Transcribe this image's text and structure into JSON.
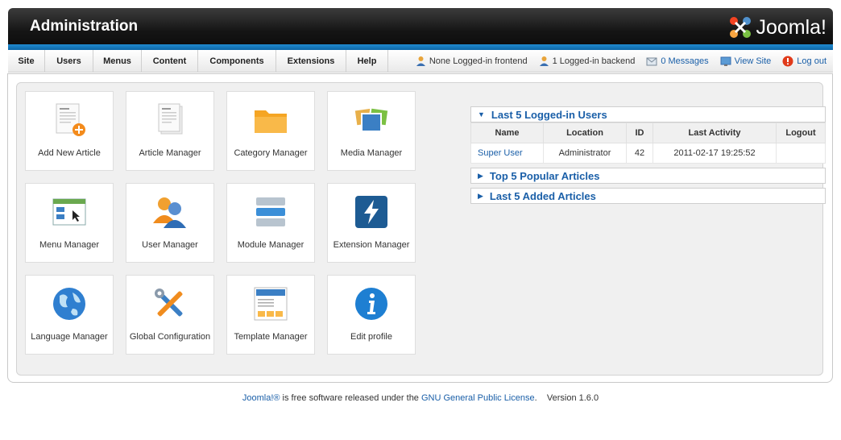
{
  "header": {
    "title": "Administration",
    "logo_text": "Joomla!"
  },
  "menu": {
    "items": [
      "Site",
      "Users",
      "Menus",
      "Content",
      "Components",
      "Extensions",
      "Help"
    ]
  },
  "status": {
    "frontend": "None Logged-in frontend",
    "backend": "1 Logged-in backend",
    "messages": "0 Messages",
    "view_site": "View Site",
    "logout": "Log out"
  },
  "quickicons": [
    {
      "label": "Add New Article",
      "icon": "add-article-icon"
    },
    {
      "label": "Article Manager",
      "icon": "article-icon"
    },
    {
      "label": "Category Manager",
      "icon": "folder-icon"
    },
    {
      "label": "Media Manager",
      "icon": "media-icon"
    },
    {
      "label": "Menu Manager",
      "icon": "menu-icon"
    },
    {
      "label": "User Manager",
      "icon": "users-icon"
    },
    {
      "label": "Module Manager",
      "icon": "module-icon"
    },
    {
      "label": "Extension Manager",
      "icon": "extension-icon"
    },
    {
      "label": "Language Manager",
      "icon": "globe-icon"
    },
    {
      "label": "Global Configuration",
      "icon": "tools-icon"
    },
    {
      "label": "Template Manager",
      "icon": "template-icon"
    },
    {
      "label": "Edit profile",
      "icon": "info-icon"
    }
  ],
  "sliders": {
    "logged": {
      "title": "Last 5 Logged-in Users",
      "columns": [
        "Name",
        "Location",
        "ID",
        "Last Activity",
        "Logout"
      ],
      "rows": [
        {
          "name": "Super User",
          "location": "Administrator",
          "id": "42",
          "activity": "2011-02-17 19:25:52",
          "logout": ""
        }
      ]
    },
    "popular": {
      "title": "Top 5 Popular Articles"
    },
    "added": {
      "title": "Last 5 Added Articles"
    }
  },
  "footer": {
    "joomla": "Joomla!®",
    "middle": " is free software released under the ",
    "license": "GNU General Public License",
    "version": "Version 1.6.0"
  },
  "colors": {
    "accent": "#1a5fa8",
    "header_bar": "#1f8bd0",
    "logout_red": "#e03a1a"
  }
}
